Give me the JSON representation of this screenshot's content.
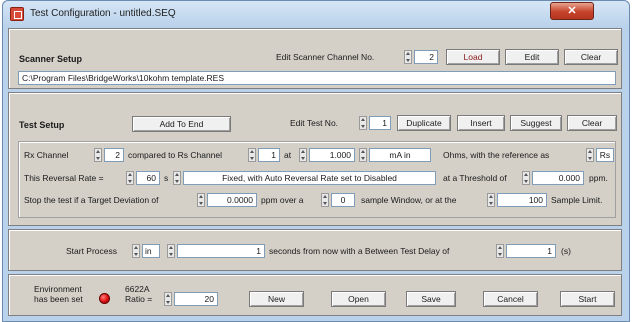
{
  "window": {
    "title": "Test Configuration - untitled.SEQ",
    "close_label": "✕"
  },
  "scanner": {
    "heading": "Scanner Setup",
    "channel_label": "Edit Scanner Channel No.",
    "channel_value": "2",
    "load_label": "Load",
    "edit_label": "Edit",
    "clear_label": "Clear",
    "path_value": "C:\\Program Files\\BridgeWorks\\10kohm template.RES"
  },
  "test": {
    "heading": "Test Setup",
    "add_to_end_label": "Add To End",
    "test_no_label": "Edit Test No.",
    "test_no_value": "1",
    "duplicate_label": "Duplicate",
    "insert_label": "Insert",
    "suggest_label": "Suggest",
    "clear_label": "Clear",
    "rx_label": "Rx Channel",
    "rx_value": "2",
    "compared_label": "compared to Rs Channel",
    "rs_value": "1",
    "at_label": "at",
    "current_value": "1.000",
    "unit_value": "mA in",
    "ohms_label": "Ohms, with the reference as",
    "ref_value": "Rs",
    "reversal_label": "This Reversal Rate =",
    "reversal_value": "60",
    "s_label": "s",
    "mode_value": "Fixed, with Auto Reversal Rate set to Disabled",
    "threshold_label": "at a Threshold of",
    "threshold_value": "0.000",
    "ppm_label": "ppm.",
    "stop_label": "Stop the test if a Target Deviation of",
    "deviation_value": "0.0000",
    "ppm_over_label": "ppm over a",
    "window_value": "0",
    "sample_window_label": "sample Window, or at the",
    "limit_value": "100",
    "sample_limit_label": "Sample Limit."
  },
  "process": {
    "start_label": "Start Process",
    "mode_value": "in",
    "seconds_value": "1",
    "seconds_label": "seconds from now with a Between Test Delay of",
    "delay_value": "1",
    "unit_label": "(s)"
  },
  "footer": {
    "env_label_1": "Environment",
    "env_label_2": "has been set",
    "ratio_label_1": "6622A",
    "ratio_label_2": "Ratio =",
    "ratio_value": "20",
    "new_label": "New",
    "open_label": "Open",
    "save_label": "Save",
    "cancel_label": "Cancel",
    "start_label": "Start"
  }
}
